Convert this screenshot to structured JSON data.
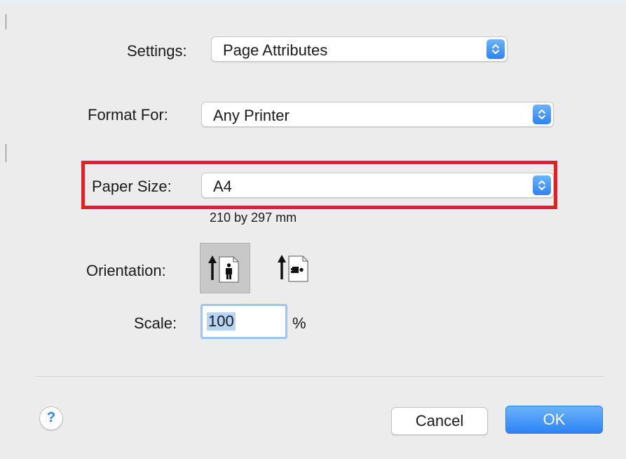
{
  "settings": {
    "label": "Settings:",
    "value": "Page Attributes"
  },
  "format_for": {
    "label": "Format For:",
    "value": "Any Printer"
  },
  "paper_size": {
    "label": "Paper Size:",
    "value": "A4",
    "dimensions": "210 by 297 mm"
  },
  "orientation": {
    "label": "Orientation:",
    "options": [
      "portrait",
      "landscape"
    ],
    "selected": "portrait"
  },
  "scale": {
    "label": "Scale:",
    "value": "100",
    "unit": "%"
  },
  "buttons": {
    "help": "?",
    "cancel": "Cancel",
    "ok": "OK"
  },
  "colors": {
    "accent": "#2d83f5",
    "highlight_box": "#ec1c24",
    "dialog_background": "#ececec"
  }
}
